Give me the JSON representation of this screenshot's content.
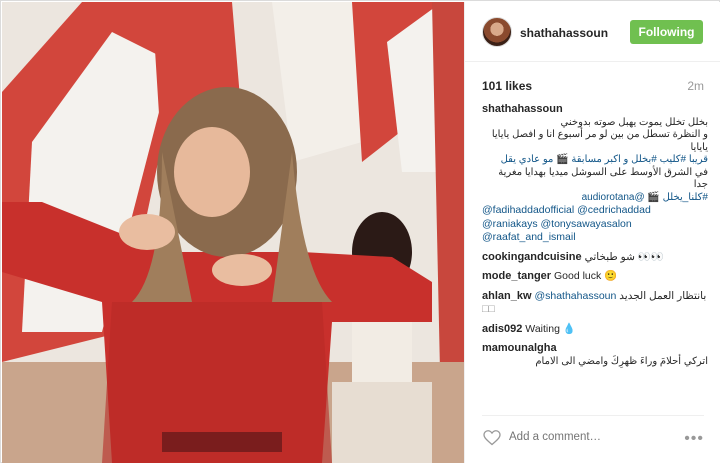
{
  "post": {
    "username": "shathahassoun",
    "follow_label": "Following",
    "likes": "101 likes",
    "time": "2m"
  },
  "caption": {
    "user": "shathahassoun",
    "lines": [
      "بخلل تخلل يموت يهبل صوته بدوخني",
      "و النظرة تسطل من بين لو مر أسبوع انا و افصل يايايا يايايا",
      "قريبا #كليب #بخلل و اكبر مسابقة 🎬 مو عادي يقل",
      "في الشرق الأوسط على السوشل ميديا بهدايا مغرية جدا",
      "#كلنا_يخلل 🎬 @audiorotana"
    ],
    "mentions": [
      "@fadihaddadofficial @cedrichaddad",
      "@raniakays @tonysawayasalon",
      "@raafat_and_ismail"
    ]
  },
  "comments": [
    {
      "user": "cookingandcuisine",
      "text": "شو طبخاتي 👀👀"
    },
    {
      "user": "mode_tanger",
      "text": "Good luck 🙂"
    },
    {
      "user": "ahlan_kw",
      "mention": "@shathahassoun",
      "text": "بانتظار العمل الجديد",
      "extra": "□□"
    },
    {
      "user": "adis092",
      "text": "Waiting 💧"
    },
    {
      "user": "mamounalgha",
      "text": "اتركي أحلامَ وراءَ ظهرِكَ وامضي الى الامام"
    }
  ],
  "footer": {
    "add_comment_placeholder": "Add a comment…",
    "more_label": "•••"
  },
  "colors": {
    "follow_bg": "#70c050",
    "link": "#125688",
    "muted": "#999999"
  }
}
